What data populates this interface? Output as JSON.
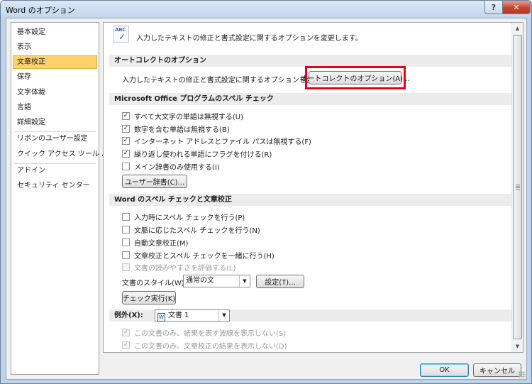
{
  "window": {
    "title": "Word のオプション",
    "help_label": "?",
    "close_label": "✕"
  },
  "nav": {
    "items": [
      {
        "label": "基本設定"
      },
      {
        "label": "表示"
      },
      {
        "label": "文章校正"
      },
      {
        "label": "保存"
      },
      {
        "label": "文字体裁"
      },
      {
        "label": "言語"
      },
      {
        "label": "詳細設定"
      },
      {
        "label": "リボンのユーザー設定"
      },
      {
        "label": "クイック アクセス ツール バー"
      },
      {
        "label": "アドイン"
      },
      {
        "label": "セキュリティ センター"
      }
    ],
    "selected": "文章校正"
  },
  "header": {
    "icon": "abc-check-icon",
    "icon_text": "ABC",
    "text": "入力したテキストの修正と書式設定に関するオプションを変更します。"
  },
  "autocorrect": {
    "heading": "オートコレクトのオプション",
    "description": "入力したテキストの修正と書式設定に関するオプションを変更します。",
    "button_label": "オートコレクトのオプション(A)..."
  },
  "office_spelling": {
    "heading": "Microsoft Office プログラムのスペル チェック",
    "options": [
      {
        "label": "すべて大文字の単語は無視する(U)",
        "checked": true
      },
      {
        "label": "数字を含む単語は無視する(B)",
        "checked": true
      },
      {
        "label": "インターネット アドレスとファイル パスは無視する(F)",
        "checked": true
      },
      {
        "label": "繰り返し使われる単語にフラグを付ける(R)",
        "checked": true
      },
      {
        "label": "メイン辞書のみ使用する(I)",
        "checked": false
      }
    ],
    "dictionary_button": "ユーザー辞書(C)..."
  },
  "word_spelling": {
    "heading": "Word のスペル チェックと文章校正",
    "options": [
      {
        "label": "入力時にスペル チェックを行う(P)",
        "checked": false,
        "disabled": false
      },
      {
        "label": "文脈に応じたスペル チェックを行う(N)",
        "checked": false,
        "disabled": false
      },
      {
        "label": "自動文章校正(M)",
        "checked": false,
        "disabled": false
      },
      {
        "label": "文章校正とスペル チェックを一緒に行う(H)",
        "checked": false,
        "disabled": false
      },
      {
        "label": "文書の読みやすさを評価する(L)",
        "checked": false,
        "disabled": true
      }
    ],
    "style_label": "文書のスタイル(W):",
    "style_value": "通常の文",
    "settings_button": "設定(T)...",
    "check_button": "チェック実行(K)"
  },
  "exceptions": {
    "heading_label": "例外(X):",
    "document_value": "文書 1",
    "options": [
      {
        "label": "この文書のみ、結果を表す波線を表示しない(S)",
        "checked": true,
        "disabled": true
      },
      {
        "label": "この文書のみ、文章校正の結果を表示しない(D)",
        "checked": true,
        "disabled": true
      }
    ]
  },
  "footer": {
    "ok_label": "OK",
    "cancel_label": "キャンセル"
  },
  "colors": {
    "highlight": "#e8001c",
    "nav_selected": "#fbd26e"
  }
}
